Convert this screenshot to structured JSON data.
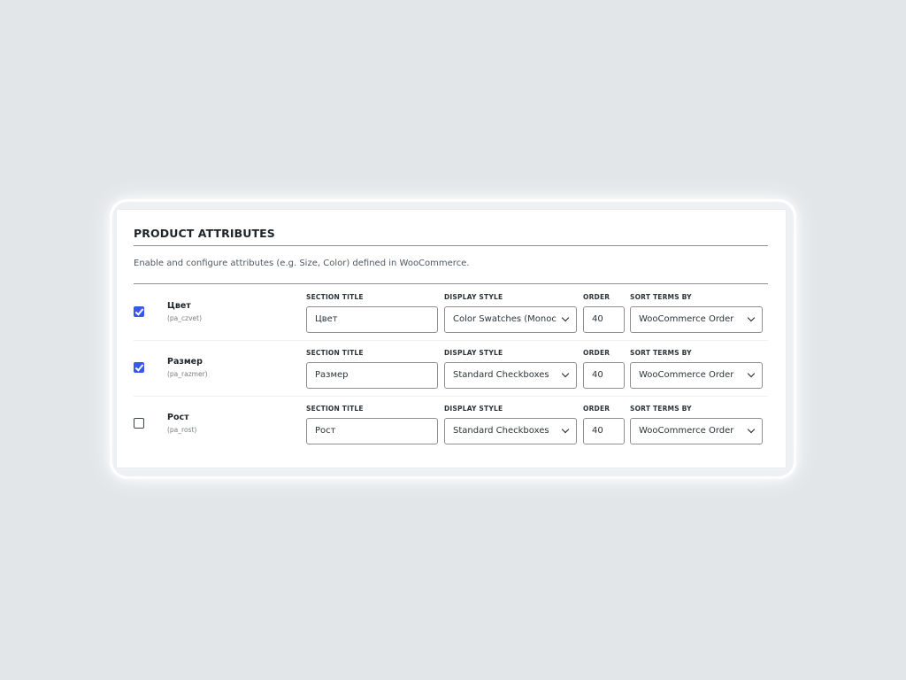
{
  "section": {
    "title": "PRODUCT ATTRIBUTES",
    "description": "Enable and configure attributes (e.g. Size, Color) defined in WooCommerce."
  },
  "columns": {
    "section_title": "SECTION TITLE",
    "display_style": "DISPLAY STYLE",
    "order": "ORDER",
    "sort_terms_by": "SORT TERMS BY"
  },
  "rows": [
    {
      "enabled": true,
      "name": "Цвет",
      "slug": "(pa_czvet)",
      "section_title": "Цвет",
      "display_style": "Color Swatches (Monochrome)",
      "order": "40",
      "sort_terms_by": "WooCommerce Order"
    },
    {
      "enabled": true,
      "name": "Размер",
      "slug": "(pa_razmer)",
      "section_title": "Размер",
      "display_style": "Standard Checkboxes",
      "order": "40",
      "sort_terms_by": "WooCommerce Order"
    },
    {
      "enabled": false,
      "name": "Рост",
      "slug": "(pa_rost)",
      "section_title": "Рост",
      "display_style": "Standard Checkboxes",
      "order": "40",
      "sort_terms_by": "WooCommerce Order"
    }
  ],
  "colors": {
    "checkbox_checked": "#3858e9",
    "page_background": "#e2e6e9",
    "card_background": "#ffffff"
  },
  "icons": {
    "checkbox_mark": "checkmark-icon",
    "select_arrow": "chevron-down-icon"
  }
}
